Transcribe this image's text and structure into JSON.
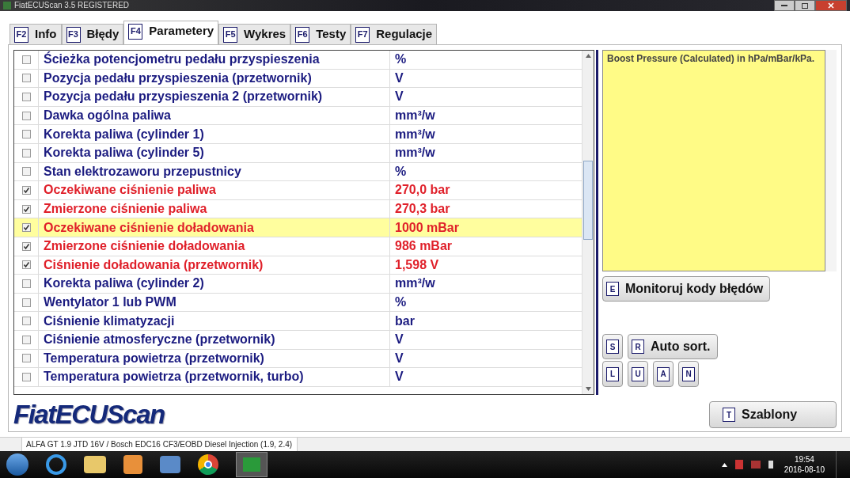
{
  "window": {
    "title": "FiatECUScan 3.5 REGISTERED"
  },
  "tabs": [
    {
      "key": "F2",
      "label": "Info",
      "selected": false
    },
    {
      "key": "F3",
      "label": "Błędy",
      "selected": false
    },
    {
      "key": "F4",
      "label": "Parametery",
      "selected": true
    },
    {
      "key": "F5",
      "label": "Wykres",
      "selected": false
    },
    {
      "key": "F6",
      "label": "Testy",
      "selected": false
    },
    {
      "key": "F7",
      "label": "Regulacje",
      "selected": false
    }
  ],
  "parameters": [
    {
      "name": "Ścieżka potencjometru pedału przyspieszenia",
      "value": "%",
      "checked": false,
      "selected": false
    },
    {
      "name": "Pozycja pedału przyspieszenia (przetwornik)",
      "value": "V",
      "checked": false,
      "selected": false
    },
    {
      "name": "Pozycja pedału przyspieszenia 2 (przetwornik)",
      "value": "V",
      "checked": false,
      "selected": false
    },
    {
      "name": "Dawka ogólna paliwa",
      "value": "mm³/w",
      "checked": false,
      "selected": false
    },
    {
      "name": "Korekta paliwa (cylinder 1)",
      "value": "mm³/w",
      "checked": false,
      "selected": false
    },
    {
      "name": "Korekta paliwa (cylinder 5)",
      "value": "mm³/w",
      "checked": false,
      "selected": false
    },
    {
      "name": "Stan elektrozaworu przepustnicy",
      "value": "%",
      "checked": false,
      "selected": false
    },
    {
      "name": "Oczekiwane ciśnienie paliwa",
      "value": "270,0 bar",
      "checked": true,
      "selected": false
    },
    {
      "name": "Zmierzone ciśnienie paliwa",
      "value": "270,3 bar",
      "checked": true,
      "selected": false
    },
    {
      "name": "Oczekiwane ciśnienie doładowania",
      "value": "1000 mBar",
      "checked": true,
      "selected": true
    },
    {
      "name": "Zmierzone ciśnienie doładowania",
      "value": "986 mBar",
      "checked": true,
      "selected": false
    },
    {
      "name": "Ciśnienie doładowania (przetwornik)",
      "value": "1,598 V",
      "checked": true,
      "selected": false
    },
    {
      "name": "Korekta paliwa (cylinder 2)",
      "value": "mm³/w",
      "checked": false,
      "selected": false
    },
    {
      "name": "Wentylator 1 lub PWM",
      "value": "%",
      "checked": false,
      "selected": false
    },
    {
      "name": "Ciśnienie klimatyzacji",
      "value": "bar",
      "checked": false,
      "selected": false
    },
    {
      "name": "Ciśnienie atmosferyczne (przetwornik)",
      "value": "V",
      "checked": false,
      "selected": false
    },
    {
      "name": "Temperatura powietrza (przetwornik)",
      "value": "V",
      "checked": false,
      "selected": false
    },
    {
      "name": "Temperatura powietrza (przetwornik, turbo)",
      "value": "V",
      "checked": false,
      "selected": false
    }
  ],
  "description": "Boost Pressure (Calculated) in hPa/mBar/kPa.",
  "monitor_button": {
    "key": "E",
    "label": "Monitoruj kody błędów"
  },
  "sort_row": [
    {
      "key": "S"
    },
    {
      "key": "R",
      "label": "Auto sort."
    }
  ],
  "letter_buttons": [
    {
      "key": "L"
    },
    {
      "key": "U"
    },
    {
      "key": "A"
    },
    {
      "key": "N"
    }
  ],
  "logo": "FiatECUScan",
  "templates_button": {
    "key": "T",
    "label": "Szablony"
  },
  "status_bar": "ALFA GT 1.9 JTD 16V / Bosch EDC16 CF3/EOBD Diesel Injection (1.9, 2.4)",
  "taskbar": {
    "time": "19:54",
    "date": "2016-08-10"
  }
}
